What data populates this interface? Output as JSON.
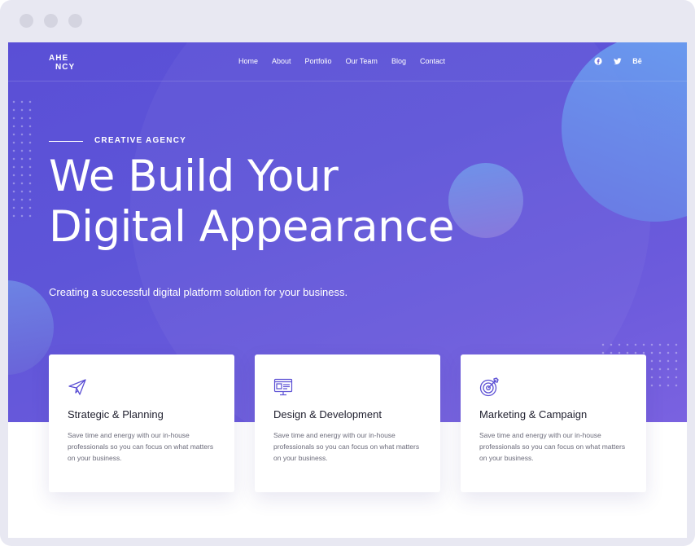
{
  "brand": {
    "logo_line1": "AHE",
    "logo_line2": "NCY"
  },
  "nav": {
    "items": [
      {
        "label": "Home"
      },
      {
        "label": "About"
      },
      {
        "label": "Portfolio"
      },
      {
        "label": "Our Team"
      },
      {
        "label": "Blog"
      },
      {
        "label": "Contact"
      }
    ]
  },
  "social": {
    "icons": [
      "facebook-icon",
      "twitter-icon",
      "behance-icon"
    ],
    "behance_label": "Bē"
  },
  "hero": {
    "eyebrow": "CREATIVE AGENCY",
    "title_line1": "We Build Your",
    "title_line2": "Digital Appearance",
    "subtitle": "Creating a successful digital platform solution for your business."
  },
  "features": [
    {
      "icon": "paper-plane-icon",
      "title": "Strategic & Planning",
      "text": "Save time and energy with our in-house professionals so you can focus on what matters on your business."
    },
    {
      "icon": "design-monitor-icon",
      "title": "Design & Development",
      "text": "Save time and energy with our in-house professionals so you can focus on what matters on your business."
    },
    {
      "icon": "target-icon",
      "title": "Marketing & Campaign",
      "text": "Save time and energy with our in-house professionals so you can focus on what matters on your business."
    }
  ],
  "colors": {
    "hero_start": "#5a4fd6",
    "hero_end": "#7a62e0",
    "accent": "#5b4fd4",
    "card_title": "#1f1f2e",
    "card_text": "#6b6b7a"
  }
}
